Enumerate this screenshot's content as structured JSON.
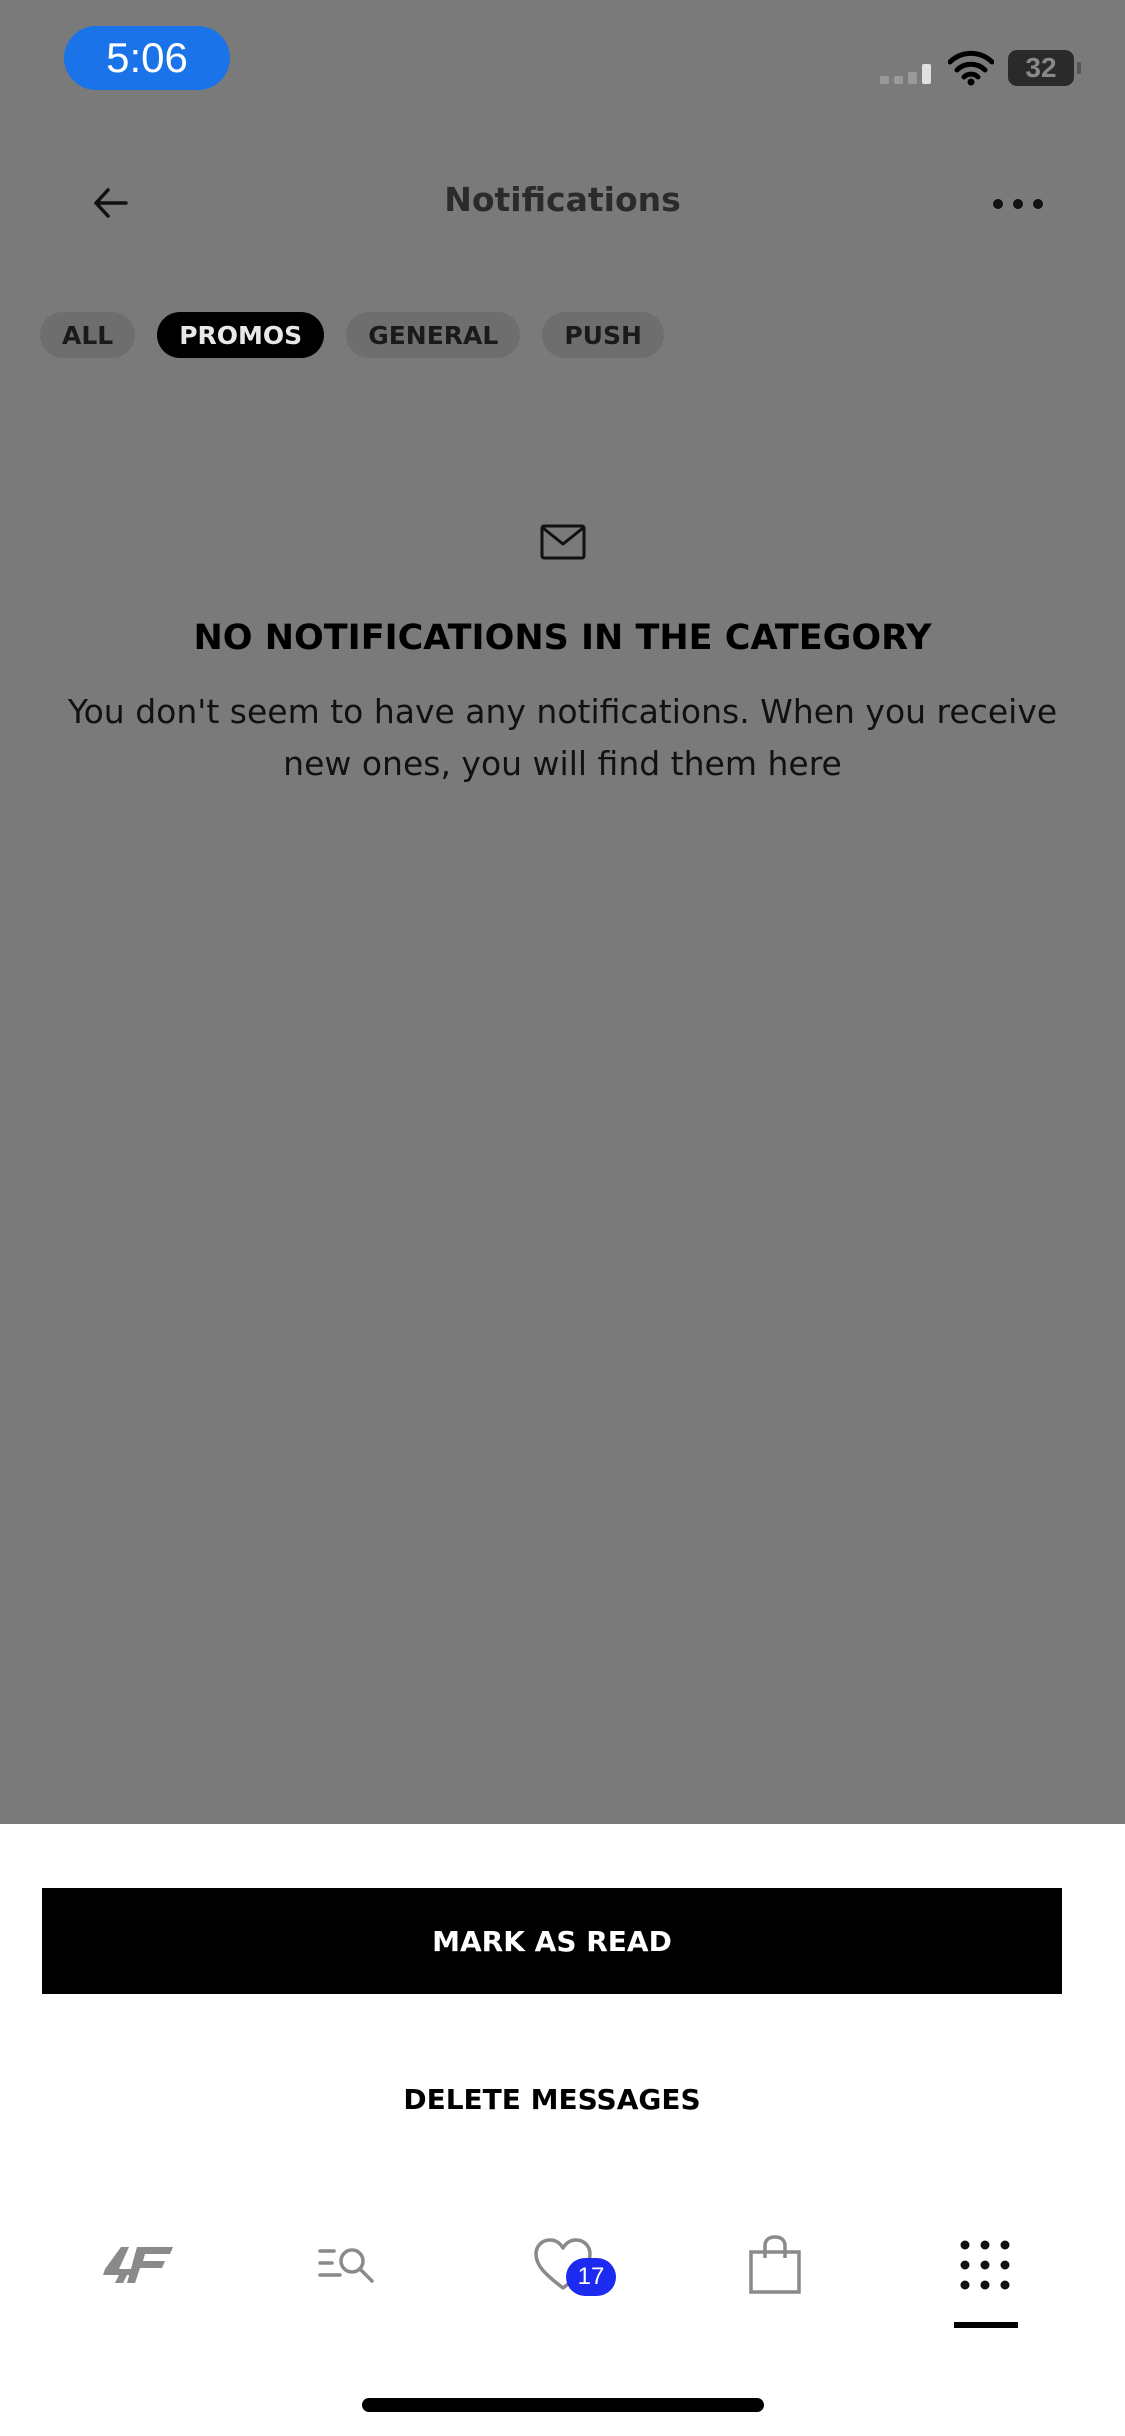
{
  "status_bar": {
    "time": "5:06",
    "battery": "32",
    "icons": [
      "signal-icon",
      "wifi-icon",
      "battery-icon"
    ]
  },
  "header": {
    "title": "Notifications",
    "icons": [
      "back-arrow-icon",
      "more-dots-icon"
    ]
  },
  "tabs": [
    {
      "label": "ALL",
      "active": false
    },
    {
      "label": "PROMOS",
      "active": true
    },
    {
      "label": "GENERAL",
      "active": false
    },
    {
      "label": "PUSH",
      "active": false
    }
  ],
  "empty_state": {
    "icon": "mail-icon",
    "title": "NO NOTIFICATIONS IN THE CATEGORY",
    "text": "You don't seem to have any notifications. When you receive new ones, you will find them here"
  },
  "sheet": {
    "mark_read_label": "MARK AS READ",
    "delete_label": "DELETE MESSAGES"
  },
  "bottom_nav": {
    "items": [
      "logo-4f-icon",
      "search-list-icon",
      "heart-icon",
      "shopping-bag-icon",
      "grid-menu-icon"
    ],
    "wishlist_count": "17",
    "active_item": "grid-menu-icon"
  },
  "colors": {
    "overlay": "#7a7a7a",
    "badge": "#1d2bf0",
    "time_pill": "#1a73e8",
    "primary_button": "#000000"
  }
}
